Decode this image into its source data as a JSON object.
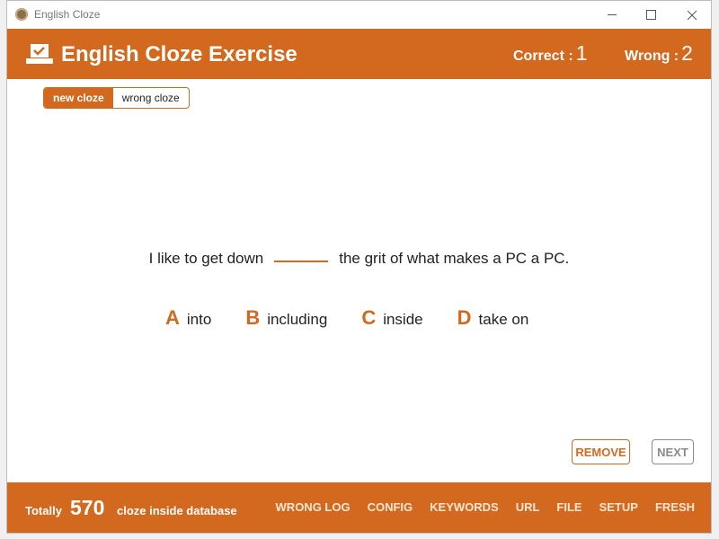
{
  "window": {
    "title": "English Cloze"
  },
  "header": {
    "title": "English Cloze Exercise",
    "correct_label": "Correct :",
    "correct_value": "1",
    "wrong_label": "Wrong :",
    "wrong_value": "2"
  },
  "mode_toggle": {
    "options": [
      "new cloze",
      "wrong cloze"
    ],
    "selected": "new cloze"
  },
  "question": {
    "before": "I like to get down",
    "after": "the grit of what makes a PC a PC."
  },
  "choices": [
    {
      "letter": "A",
      "text": "into"
    },
    {
      "letter": "B",
      "text": "including"
    },
    {
      "letter": "C",
      "text": "inside"
    },
    {
      "letter": "D",
      "text": "take on"
    }
  ],
  "actions": {
    "remove": "REMOVE",
    "next": "NEXT"
  },
  "footer": {
    "total_label": "Totally",
    "total_count": "570",
    "total_suffix": "cloze inside database",
    "links": [
      "WRONG LOG",
      "CONFIG",
      "KEYWORDS",
      "URL",
      "FILE",
      "SETUP",
      "FRESH"
    ]
  },
  "colors": {
    "accent": "#d2691e",
    "text": "#222222",
    "disabled": "#8a8a8a"
  },
  "icons": {
    "app": "app-icon",
    "header": "laptop-check-icon"
  }
}
